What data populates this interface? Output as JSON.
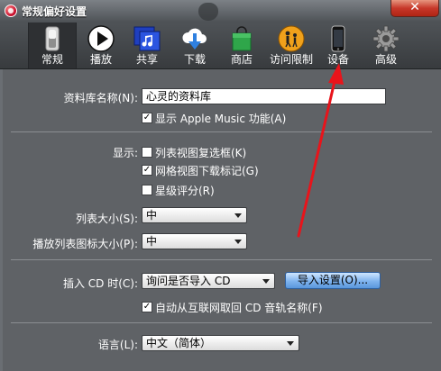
{
  "window": {
    "title": "常规偏好设置",
    "close_glyph": "✕"
  },
  "toolbar": {
    "tabs": [
      {
        "label": "常规",
        "icon": "general-switch-icon"
      },
      {
        "label": "播放",
        "icon": "play-icon"
      },
      {
        "label": "共享",
        "icon": "music-note-folder-icon"
      },
      {
        "label": "下载",
        "icon": "cloud-download-icon"
      },
      {
        "label": "商店",
        "icon": "shopping-bag-icon"
      },
      {
        "label": "访问限制",
        "icon": "parental-restriction-icon"
      },
      {
        "label": "设备",
        "icon": "iphone-icon"
      },
      {
        "label": "高级",
        "icon": "gear-icon"
      }
    ],
    "selected": "常规"
  },
  "library": {
    "name_label": "资料库名称(N):",
    "name_value": "心灵的资料库",
    "show_apple_music_label": "显示 Apple Music 功能(A)",
    "show_apple_music_checked": true
  },
  "display": {
    "label": "显示:",
    "options": [
      {
        "label": "列表视图复选框(K)",
        "checked": false
      },
      {
        "label": "网格视图下载标记(G)",
        "checked": true
      },
      {
        "label": "星级评分(R)",
        "checked": false
      }
    ]
  },
  "sizes": {
    "list_size_label": "列表大小(S):",
    "list_size_value": "中",
    "playlist_icon_size_label": "播放列表图标大小(P):",
    "playlist_icon_size_value": "中"
  },
  "cd": {
    "insert_label": "插入 CD 时(C):",
    "insert_value": "询问是否导入 CD",
    "import_settings_button": "导入设置(O)...",
    "auto_fetch_label": "自动从互联网取回 CD 音轨名称(F)",
    "auto_fetch_checked": true
  },
  "language": {
    "label": "语言(L):",
    "value": "中文（简体）"
  },
  "colors": {
    "annotation_arrow": "#e8141b",
    "selected_tab_bg": "#2e3033"
  }
}
